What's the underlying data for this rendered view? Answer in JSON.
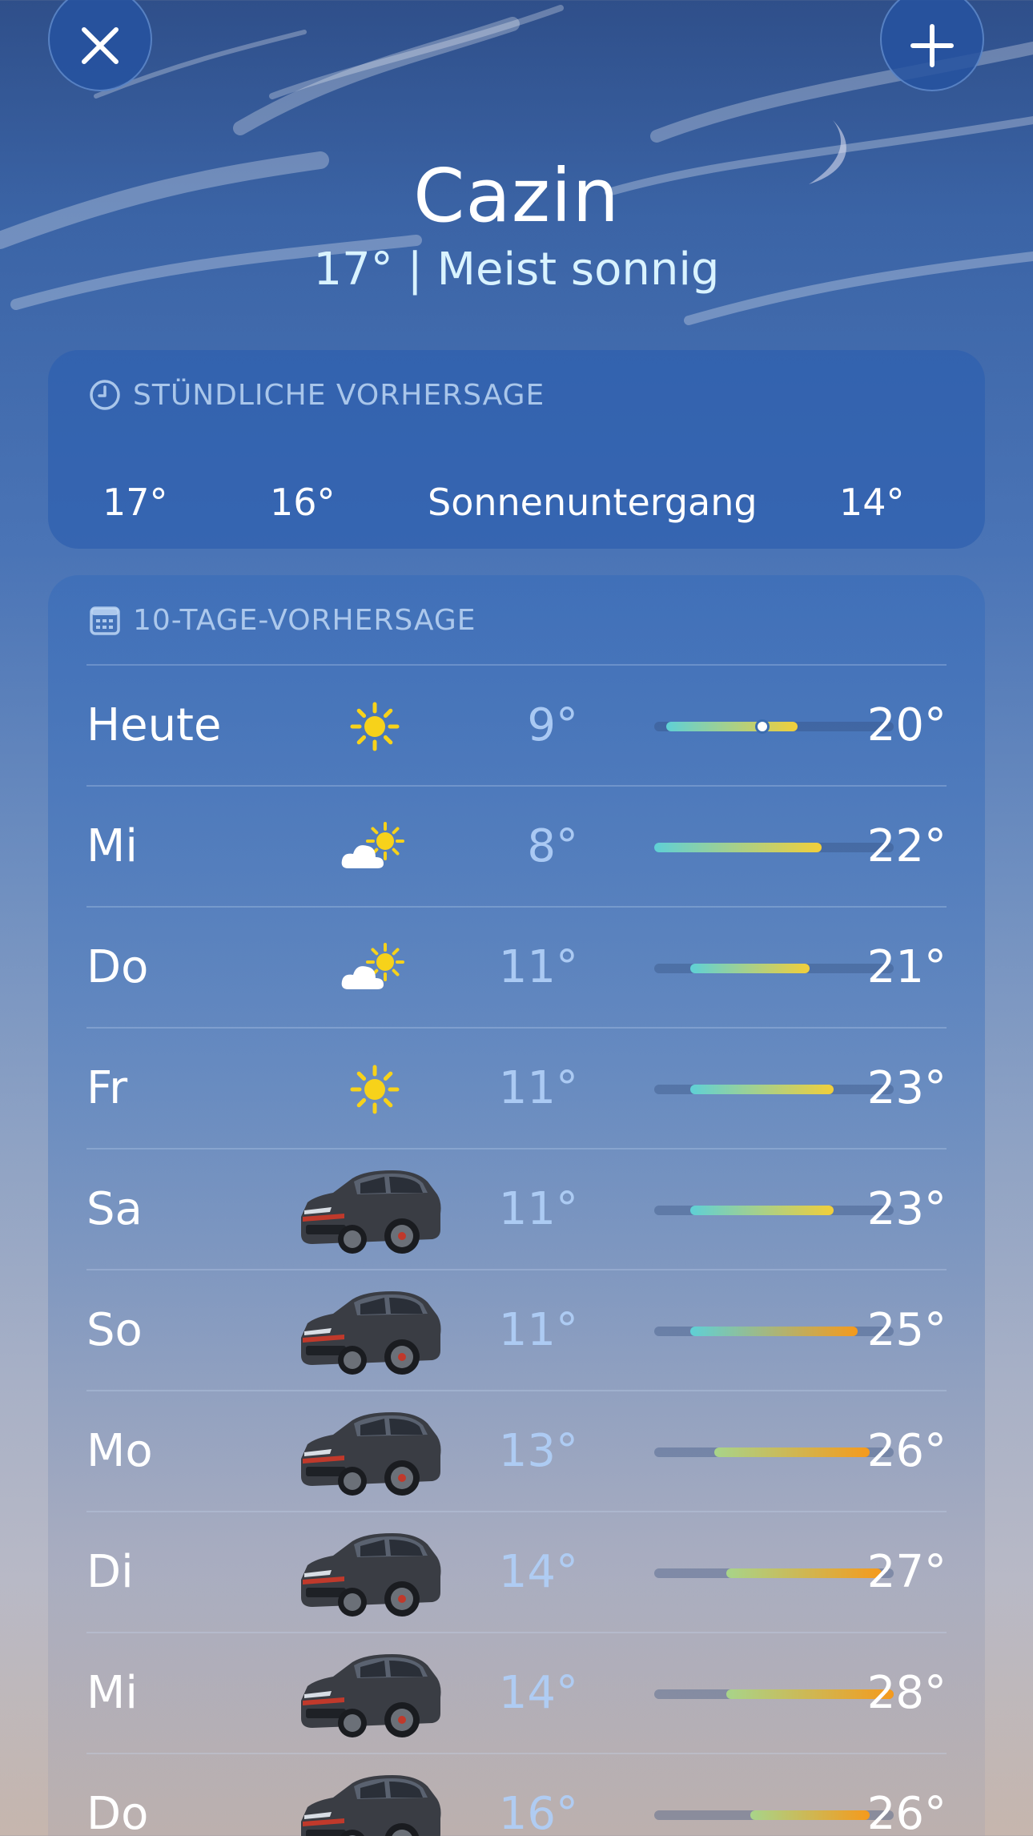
{
  "header": {
    "city": "Cazin",
    "temperature": "17°",
    "separator": "|",
    "condition": "Meist sonnig"
  },
  "buttons": {
    "close_icon": "close-icon",
    "add_icon": "plus-icon"
  },
  "hourly": {
    "title": "STÜNDLICHE VORHERSAGE",
    "icon": "clock-icon",
    "items": [
      "17°",
      "16°",
      "Sonnenuntergang",
      "14°"
    ]
  },
  "daily": {
    "title": "10-TAGE-VORHERSAGE",
    "icon": "calendar-icon",
    "scale_min": 8,
    "scale_max": 28,
    "current_temp": 17,
    "days": [
      {
        "day": "Heute",
        "icon": "sun-icon",
        "low": "9°",
        "high": "20°",
        "low_val": 9,
        "high_val": 20
      },
      {
        "day": "Mi",
        "icon": "partly-cloudy-icon",
        "low": "8°",
        "high": "22°",
        "low_val": 8,
        "high_val": 22
      },
      {
        "day": "Do",
        "icon": "partly-cloudy-icon",
        "low": "11°",
        "high": "21°",
        "low_val": 11,
        "high_val": 21
      },
      {
        "day": "Fr",
        "icon": "sun-icon",
        "low": "11°",
        "high": "23°",
        "low_val": 11,
        "high_val": 23
      },
      {
        "day": "Sa",
        "icon": "car-image",
        "low": "11°",
        "high": "23°",
        "low_val": 11,
        "high_val": 23
      },
      {
        "day": "So",
        "icon": "car-image",
        "low": "11°",
        "high": "25°",
        "low_val": 11,
        "high_val": 25
      },
      {
        "day": "Mo",
        "icon": "car-image",
        "low": "13°",
        "high": "26°",
        "low_val": 13,
        "high_val": 26
      },
      {
        "day": "Di",
        "icon": "car-image",
        "low": "14°",
        "high": "27°",
        "low_val": 14,
        "high_val": 27
      },
      {
        "day": "Mi",
        "icon": "car-image",
        "low": "14°",
        "high": "28°",
        "low_val": 14,
        "high_val": 28
      },
      {
        "day": "Do",
        "icon": "car-image",
        "low": "16°",
        "high": "26°",
        "low_val": 16,
        "high_val": 26
      }
    ]
  },
  "colors": {
    "cool": "#5fd0d6",
    "mild": "#a8d48a",
    "warm": "#f2cf3a",
    "hot": "#f59a1c",
    "sun": "#f7d21a"
  }
}
